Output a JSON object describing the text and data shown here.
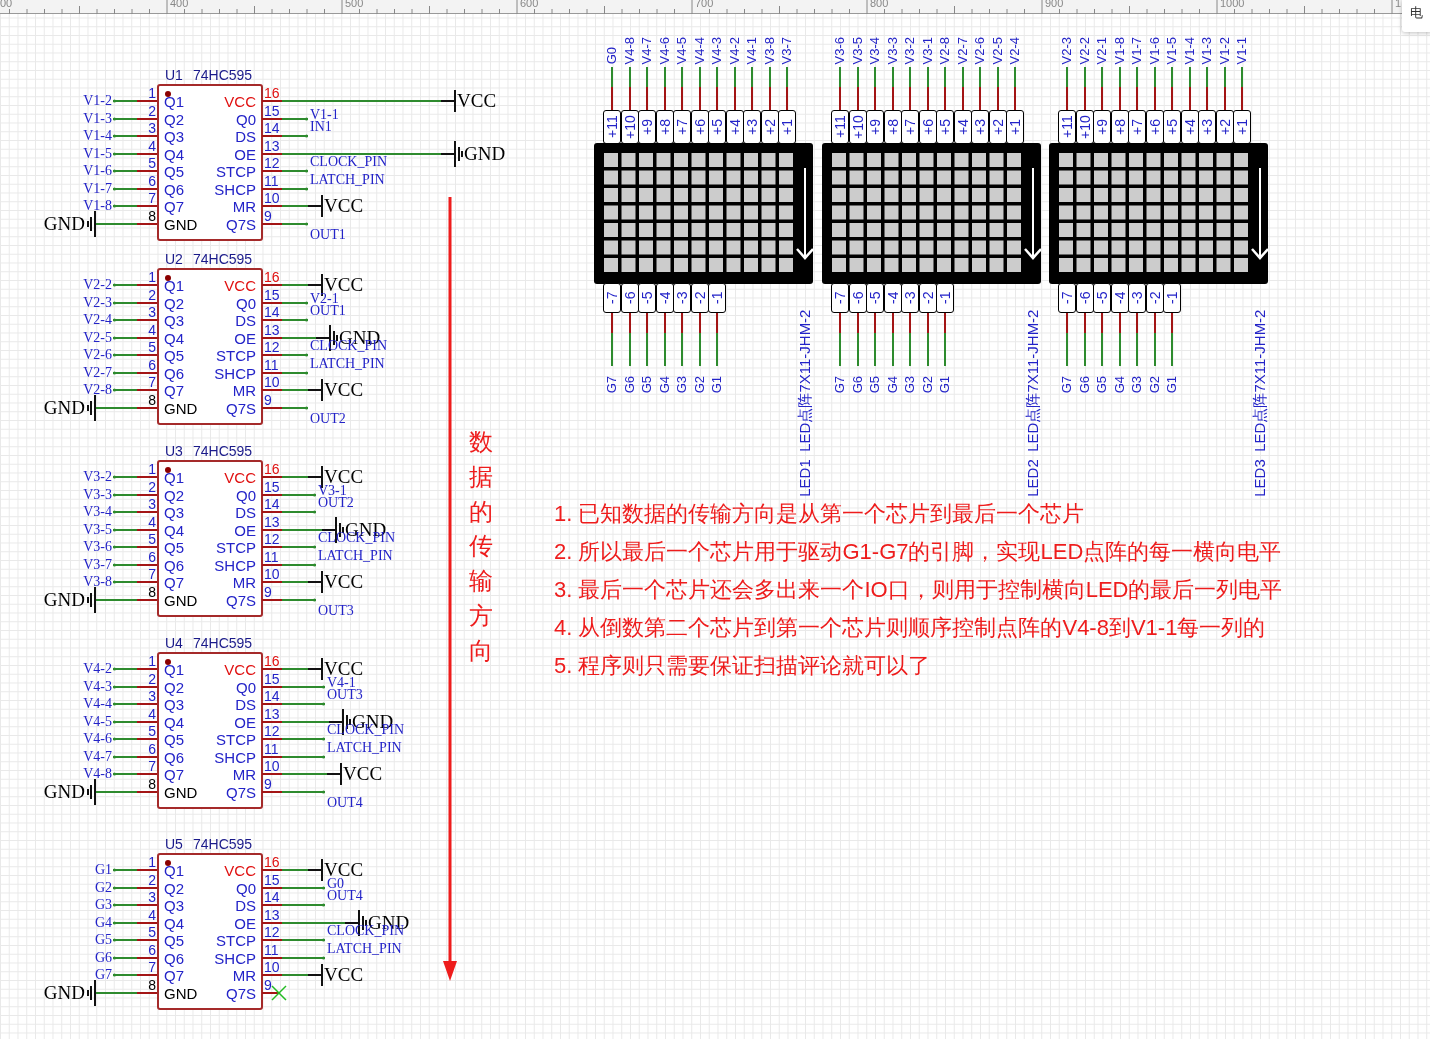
{
  "ruler": {
    "labels": [
      "00",
      "400",
      "500",
      "600",
      "700",
      "800",
      "900",
      "1000",
      "1"
    ]
  },
  "panel_tab": {
    "label": "电"
  },
  "chips": [
    {
      "ref": "U1",
      "part": "74HC595",
      "left_pins": [
        {
          "number": "1",
          "name": "Q1",
          "net": "V1-2",
          "kind": "label",
          "color": "#2323c8"
        },
        {
          "number": "2",
          "name": "Q2",
          "net": "V1-3",
          "kind": "label",
          "color": "#2323c8"
        },
        {
          "number": "3",
          "name": "Q3",
          "net": "V1-4",
          "kind": "label",
          "color": "#2323c8"
        },
        {
          "number": "4",
          "name": "Q4",
          "net": "V1-5",
          "kind": "label",
          "color": "#2323c8"
        },
        {
          "number": "5",
          "name": "Q5",
          "net": "V1-6",
          "kind": "label",
          "color": "#2323c8"
        },
        {
          "number": "6",
          "name": "Q6",
          "net": "V1-7",
          "kind": "label",
          "color": "#2323c8"
        },
        {
          "number": "7",
          "name": "Q7",
          "net": "V1-8",
          "kind": "label",
          "color": "#2323c8"
        },
        {
          "number": "8",
          "name": "GND",
          "net": "GND",
          "kind": "ground",
          "color": "#000000"
        }
      ],
      "right_pins": [
        {
          "number": "16",
          "name": "VCC",
          "net": "VCC",
          "kind": "power",
          "color": "#e01010"
        },
        {
          "number": "15",
          "name": "Q0",
          "net": "V1-1",
          "kind": "label",
          "color": "#2323c8"
        },
        {
          "number": "14",
          "name": "DS",
          "net": "IN1",
          "kind": "label",
          "color": "#2323c8"
        },
        {
          "number": "13",
          "name": "OE",
          "net": "GND",
          "kind": "ground",
          "color": "#2323c8"
        },
        {
          "number": "12",
          "name": "STCP",
          "net": "CLOCK_PIN",
          "kind": "label",
          "color": "#2323c8"
        },
        {
          "number": "11",
          "name": "SHCP",
          "net": "LATCH_PIN",
          "kind": "label",
          "color": "#2323c8"
        },
        {
          "number": "10",
          "name": "MR",
          "net": "VCC",
          "kind": "power",
          "color": "#2323c8"
        },
        {
          "number": "9",
          "name": "Q7S",
          "net": "OUT1",
          "kind": "label",
          "color": "#2323c8"
        }
      ]
    },
    {
      "ref": "U2",
      "part": "74HC595",
      "left_pins": [
        {
          "number": "1",
          "name": "Q1",
          "net": "V2-2",
          "kind": "label",
          "color": "#2323c8"
        },
        {
          "number": "2",
          "name": "Q2",
          "net": "V2-3",
          "kind": "label",
          "color": "#2323c8"
        },
        {
          "number": "3",
          "name": "Q3",
          "net": "V2-4",
          "kind": "label",
          "color": "#2323c8"
        },
        {
          "number": "4",
          "name": "Q4",
          "net": "V2-5",
          "kind": "label",
          "color": "#2323c8"
        },
        {
          "number": "5",
          "name": "Q5",
          "net": "V2-6",
          "kind": "label",
          "color": "#2323c8"
        },
        {
          "number": "6",
          "name": "Q6",
          "net": "V2-7",
          "kind": "label",
          "color": "#2323c8"
        },
        {
          "number": "7",
          "name": "Q7",
          "net": "V2-8",
          "kind": "label",
          "color": "#2323c8"
        },
        {
          "number": "8",
          "name": "GND",
          "net": "GND",
          "kind": "ground",
          "color": "#000000"
        }
      ],
      "right_pins": [
        {
          "number": "16",
          "name": "VCC",
          "net": "VCC",
          "kind": "power",
          "color": "#e01010"
        },
        {
          "number": "15",
          "name": "Q0",
          "net": "V2-1",
          "kind": "label",
          "color": "#2323c8"
        },
        {
          "number": "14",
          "name": "DS",
          "net": "OUT1",
          "kind": "label",
          "color": "#2323c8"
        },
        {
          "number": "13",
          "name": "OE",
          "net": "GND",
          "kind": "ground",
          "color": "#2323c8"
        },
        {
          "number": "12",
          "name": "STCP",
          "net": "CLOCK_PIN",
          "kind": "label",
          "color": "#2323c8"
        },
        {
          "number": "11",
          "name": "SHCP",
          "net": "LATCH_PIN",
          "kind": "label",
          "color": "#2323c8"
        },
        {
          "number": "10",
          "name": "MR",
          "net": "VCC",
          "kind": "power",
          "color": "#2323c8"
        },
        {
          "number": "9",
          "name": "Q7S",
          "net": "OUT2",
          "kind": "label",
          "color": "#2323c8"
        }
      ]
    },
    {
      "ref": "U3",
      "part": "74HC595",
      "left_pins": [
        {
          "number": "1",
          "name": "Q1",
          "net": "V3-2",
          "kind": "label",
          "color": "#2323c8"
        },
        {
          "number": "2",
          "name": "Q2",
          "net": "V3-3",
          "kind": "label",
          "color": "#2323c8"
        },
        {
          "number": "3",
          "name": "Q3",
          "net": "V3-4",
          "kind": "label",
          "color": "#2323c8"
        },
        {
          "number": "4",
          "name": "Q4",
          "net": "V3-5",
          "kind": "label",
          "color": "#2323c8"
        },
        {
          "number": "5",
          "name": "Q5",
          "net": "V3-6",
          "kind": "label",
          "color": "#2323c8"
        },
        {
          "number": "6",
          "name": "Q6",
          "net": "V3-7",
          "kind": "label",
          "color": "#2323c8"
        },
        {
          "number": "7",
          "name": "Q7",
          "net": "V3-8",
          "kind": "label",
          "color": "#2323c8"
        },
        {
          "number": "8",
          "name": "GND",
          "net": "GND",
          "kind": "ground",
          "color": "#000000"
        }
      ],
      "right_pins": [
        {
          "number": "16",
          "name": "VCC",
          "net": "VCC",
          "kind": "power",
          "color": "#e01010"
        },
        {
          "number": "15",
          "name": "Q0",
          "net": "V3-1",
          "kind": "label",
          "color": "#2323c8"
        },
        {
          "number": "14",
          "name": "DS",
          "net": "OUT2",
          "kind": "label",
          "color": "#2323c8"
        },
        {
          "number": "13",
          "name": "OE",
          "net": "GND",
          "kind": "ground",
          "color": "#2323c8"
        },
        {
          "number": "12",
          "name": "STCP",
          "net": "CLOCK_PIN",
          "kind": "label",
          "color": "#2323c8"
        },
        {
          "number": "11",
          "name": "SHCP",
          "net": "LATCH_PIN",
          "kind": "label",
          "color": "#2323c8"
        },
        {
          "number": "10",
          "name": "MR",
          "net": "VCC",
          "kind": "power",
          "color": "#2323c8"
        },
        {
          "number": "9",
          "name": "Q7S",
          "net": "OUT3",
          "kind": "label",
          "color": "#2323c8"
        }
      ]
    },
    {
      "ref": "U4",
      "part": "74HC595",
      "left_pins": [
        {
          "number": "1",
          "name": "Q1",
          "net": "V4-2",
          "kind": "label",
          "color": "#2323c8"
        },
        {
          "number": "2",
          "name": "Q2",
          "net": "V4-3",
          "kind": "label",
          "color": "#2323c8"
        },
        {
          "number": "3",
          "name": "Q3",
          "net": "V4-4",
          "kind": "label",
          "color": "#2323c8"
        },
        {
          "number": "4",
          "name": "Q4",
          "net": "V4-5",
          "kind": "label",
          "color": "#2323c8"
        },
        {
          "number": "5",
          "name": "Q5",
          "net": "V4-6",
          "kind": "label",
          "color": "#2323c8"
        },
        {
          "number": "6",
          "name": "Q6",
          "net": "V4-7",
          "kind": "label",
          "color": "#2323c8"
        },
        {
          "number": "7",
          "name": "Q7",
          "net": "V4-8",
          "kind": "label",
          "color": "#2323c8"
        },
        {
          "number": "8",
          "name": "GND",
          "net": "GND",
          "kind": "ground",
          "color": "#000000"
        }
      ],
      "right_pins": [
        {
          "number": "16",
          "name": "VCC",
          "net": "VCC",
          "kind": "power",
          "color": "#e01010"
        },
        {
          "number": "15",
          "name": "Q0",
          "net": "V4-1",
          "kind": "label",
          "color": "#2323c8"
        },
        {
          "number": "14",
          "name": "DS",
          "net": "OUT3",
          "kind": "label",
          "color": "#2323c8"
        },
        {
          "number": "13",
          "name": "OE",
          "net": "GND",
          "kind": "ground",
          "color": "#2323c8"
        },
        {
          "number": "12",
          "name": "STCP",
          "net": "CLOCK_PIN",
          "kind": "label",
          "color": "#2323c8"
        },
        {
          "number": "11",
          "name": "SHCP",
          "net": "LATCH_PIN",
          "kind": "label",
          "color": "#2323c8"
        },
        {
          "number": "10",
          "name": "MR",
          "net": "VCC",
          "kind": "power",
          "color": "#2323c8"
        },
        {
          "number": "9",
          "name": "Q7S",
          "net": "OUT4",
          "kind": "label",
          "color": "#2323c8"
        }
      ]
    },
    {
      "ref": "U5",
      "part": "74HC595",
      "left_pins": [
        {
          "number": "1",
          "name": "Q1",
          "net": "G1",
          "kind": "label",
          "color": "#2323c8"
        },
        {
          "number": "2",
          "name": "Q2",
          "net": "G2",
          "kind": "label",
          "color": "#2323c8"
        },
        {
          "number": "3",
          "name": "Q3",
          "net": "G3",
          "kind": "label",
          "color": "#2323c8"
        },
        {
          "number": "4",
          "name": "Q4",
          "net": "G4",
          "kind": "label",
          "color": "#2323c8"
        },
        {
          "number": "5",
          "name": "Q5",
          "net": "G5",
          "kind": "label",
          "color": "#2323c8"
        },
        {
          "number": "6",
          "name": "Q6",
          "net": "G6",
          "kind": "label",
          "color": "#2323c8"
        },
        {
          "number": "7",
          "name": "Q7",
          "net": "G7",
          "kind": "label",
          "color": "#2323c8"
        },
        {
          "number": "8",
          "name": "GND",
          "net": "GND",
          "kind": "ground",
          "color": "#000000"
        }
      ],
      "right_pins": [
        {
          "number": "16",
          "name": "VCC",
          "net": "VCC",
          "kind": "power",
          "color": "#e01010"
        },
        {
          "number": "15",
          "name": "Q0",
          "net": "G0",
          "kind": "label",
          "color": "#2323c8"
        },
        {
          "number": "14",
          "name": "DS",
          "net": "OUT4",
          "kind": "label",
          "color": "#2323c8"
        },
        {
          "number": "13",
          "name": "OE",
          "net": "GND",
          "kind": "ground",
          "color": "#2323c8"
        },
        {
          "number": "12",
          "name": "STCP",
          "net": "CLOCK_PIN",
          "kind": "label",
          "color": "#2323c8"
        },
        {
          "number": "11",
          "name": "SHCP",
          "net": "LATCH_PIN",
          "kind": "label",
          "color": "#2323c8"
        },
        {
          "number": "10",
          "name": "MR",
          "net": "VCC",
          "kind": "power",
          "color": "#2323c8"
        },
        {
          "number": "9",
          "name": "Q7S",
          "kind": "noconnect",
          "color": "#2323c8"
        }
      ]
    }
  ],
  "matrices": [
    {
      "ref": "LED1",
      "part": "LED点阵7X11-JHM-2",
      "top_pins": [
        {
          "number": "+11",
          "net": "G0"
        },
        {
          "number": "+10",
          "net": "V4-8"
        },
        {
          "number": "+9",
          "net": "V4-7"
        },
        {
          "number": "+8",
          "net": "V4-6"
        },
        {
          "number": "+7",
          "net": "V4-5"
        },
        {
          "number": "+6",
          "net": "V4-4"
        },
        {
          "number": "+5",
          "net": "V4-3"
        },
        {
          "number": "+4",
          "net": "V4-2"
        },
        {
          "number": "+3",
          "net": "V4-1"
        },
        {
          "number": "+2",
          "net": "V3-8"
        },
        {
          "number": "+1",
          "net": "V3-7"
        }
      ],
      "bottom_pins": [
        {
          "number": "-7",
          "net": "G7"
        },
        {
          "number": "-6",
          "net": "G6"
        },
        {
          "number": "-5",
          "net": "G5"
        },
        {
          "number": "-4",
          "net": "G4"
        },
        {
          "number": "-3",
          "net": "G3"
        },
        {
          "number": "-2",
          "net": "G2"
        },
        {
          "number": "-1",
          "net": "G1"
        }
      ]
    },
    {
      "ref": "LED2",
      "part": "LED点阵7X11-JHM-2",
      "top_pins": [
        {
          "number": "+11",
          "net": "V3-6"
        },
        {
          "number": "+10",
          "net": "V3-5"
        },
        {
          "number": "+9",
          "net": "V3-4"
        },
        {
          "number": "+8",
          "net": "V3-3"
        },
        {
          "number": "+7",
          "net": "V3-2"
        },
        {
          "number": "+6",
          "net": "V3-1"
        },
        {
          "number": "+5",
          "net": "V2-8"
        },
        {
          "number": "+4",
          "net": "V2-7"
        },
        {
          "number": "+3",
          "net": "V2-6"
        },
        {
          "number": "+2",
          "net": "V2-5"
        },
        {
          "number": "+1",
          "net": "V2-4"
        }
      ],
      "bottom_pins": [
        {
          "number": "-7",
          "net": "G7"
        },
        {
          "number": "-6",
          "net": "G6"
        },
        {
          "number": "-5",
          "net": "G5"
        },
        {
          "number": "-4",
          "net": "G4"
        },
        {
          "number": "-3",
          "net": "G3"
        },
        {
          "number": "-2",
          "net": "G2"
        },
        {
          "number": "-1",
          "net": "G1"
        }
      ]
    },
    {
      "ref": "LED3",
      "part": "LED点阵7X11-JHM-2",
      "top_pins": [
        {
          "number": "+11",
          "net": "V2-3"
        },
        {
          "number": "+10",
          "net": "V2-2"
        },
        {
          "number": "+9",
          "net": "V2-1"
        },
        {
          "number": "+8",
          "net": "V1-8"
        },
        {
          "number": "+7",
          "net": "V1-7"
        },
        {
          "number": "+6",
          "net": "V1-6"
        },
        {
          "number": "+5",
          "net": "V1-5"
        },
        {
          "number": "+4",
          "net": "V1-4"
        },
        {
          "number": "+3",
          "net": "V1-3"
        },
        {
          "number": "+2",
          "net": "V1-2"
        },
        {
          "number": "+1",
          "net": "V1-1"
        }
      ],
      "bottom_pins": [
        {
          "number": "-7",
          "net": "G7"
        },
        {
          "number": "-6",
          "net": "G6"
        },
        {
          "number": "-5",
          "net": "G5"
        },
        {
          "number": "-4",
          "net": "G4"
        },
        {
          "number": "-3",
          "net": "G3"
        },
        {
          "number": "-2",
          "net": "G2"
        },
        {
          "number": "-1",
          "net": "G1"
        }
      ]
    }
  ],
  "flow_label": "数据的传输方向",
  "notes": [
    "1. 已知数据的传输方向是从第一个芯片到最后一个芯片",
    "2. 所以最后一个芯片用于驱动G1-G7的引脚，实现LED点阵的每一横向电平",
    "3. 最后一个芯片还会多出来一个IO口，则用于控制横向LED的最后一列电平",
    "4. 从倒数第二个芯片到第一个芯片则顺序控制点阵的V4-8到V1-1每一列的",
    "5. 程序则只需要保证扫描评论就可以了"
  ]
}
